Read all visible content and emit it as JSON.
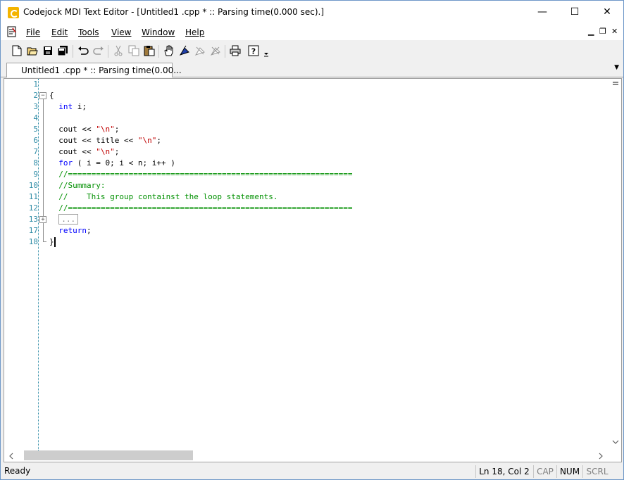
{
  "window": {
    "title": "Codejock MDI Text Editor - [Untitled1 .cpp *  ::  Parsing time(0.000 sec).]",
    "minimize": "—",
    "maximize": "☐",
    "close": "✕"
  },
  "menu": {
    "items": [
      "File",
      "Edit",
      "Tools",
      "View",
      "Window",
      "Help"
    ],
    "mdi_minimize": "▁",
    "mdi_restore": "❐",
    "mdi_close": "✕"
  },
  "toolbar": {
    "buttons": [
      "new-icon",
      "open-icon",
      "save-icon",
      "save-all-icon",
      "undo-icon",
      "redo-icon",
      "cut-icon",
      "copy-icon",
      "paste-icon",
      "hand-icon",
      "bookmark-icon",
      "find-icon",
      "replace-icon",
      "print-icon",
      "help-icon",
      "overflow-icon"
    ]
  },
  "tabs": {
    "active": "Untitled1 .cpp *  ::  Parsing time(0.00..."
  },
  "editor": {
    "line_numbers": [
      "1",
      "2",
      "3",
      "4",
      "5",
      "6",
      "7",
      "8",
      "9",
      "10",
      "11",
      "12",
      "13",
      "17",
      "18"
    ],
    "lines": [
      [],
      [
        {
          "t": "{",
          "c": "plain"
        }
      ],
      [
        {
          "t": "  ",
          "c": "plain"
        },
        {
          "t": "int",
          "c": "kw"
        },
        {
          "t": " i;",
          "c": "plain"
        }
      ],
      [],
      [
        {
          "t": "  cout << ",
          "c": "plain"
        },
        {
          "t": "\"\\n\"",
          "c": "str"
        },
        {
          "t": ";",
          "c": "plain"
        }
      ],
      [
        {
          "t": "  cout << title << ",
          "c": "plain"
        },
        {
          "t": "\"\\n\"",
          "c": "str"
        },
        {
          "t": ";",
          "c": "plain"
        }
      ],
      [
        {
          "t": "  cout << ",
          "c": "plain"
        },
        {
          "t": "\"\\n\"",
          "c": "str"
        },
        {
          "t": ";",
          "c": "plain"
        }
      ],
      [
        {
          "t": "  ",
          "c": "plain"
        },
        {
          "t": "for",
          "c": "kw"
        },
        {
          "t": " ( i = 0; i < n; i++ )",
          "c": "plain"
        }
      ],
      [
        {
          "t": "  //=============================================================",
          "c": "cm"
        }
      ],
      [
        {
          "t": "  //Summary:",
          "c": "cm"
        }
      ],
      [
        {
          "t": "  //    This group containst the loop statements.",
          "c": "cm"
        }
      ],
      [
        {
          "t": "  //=============================================================",
          "c": "cm"
        }
      ],
      [
        {
          "t": "  ",
          "c": "plain"
        },
        {
          "t": "...",
          "c": "collapsed"
        }
      ],
      [
        {
          "t": "  ",
          "c": "plain"
        },
        {
          "t": "return",
          "c": "kw"
        },
        {
          "t": ";",
          "c": "plain"
        }
      ],
      [
        {
          "t": "}",
          "c": "plain"
        }
      ]
    ]
  },
  "status": {
    "ready": "Ready",
    "position": "Ln 18, Col 2",
    "cap": "CAP",
    "num": "NUM",
    "scrl": "SCRL"
  },
  "colors": {
    "keyword": "#0000ff",
    "string": "#c00000",
    "comment": "#009000",
    "line_number": "#2f8ca6"
  }
}
